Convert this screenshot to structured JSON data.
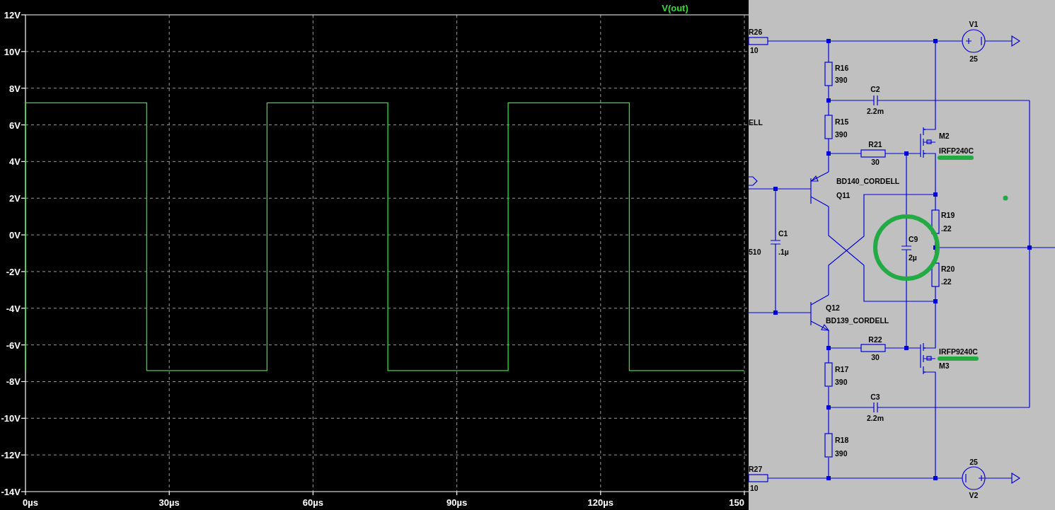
{
  "plot": {
    "chart_data": {
      "type": "line",
      "title": "V(out)",
      "grid": true,
      "xlim": [
        0,
        150
      ],
      "ylim": [
        -14,
        12
      ],
      "xticks": [
        {
          "value": 0,
          "label": "0µs"
        },
        {
          "value": 30,
          "label": "30µs"
        },
        {
          "value": 60,
          "label": "60µs"
        },
        {
          "value": 90,
          "label": "90µs"
        },
        {
          "value": 120,
          "label": "120µs"
        },
        {
          "value": 150,
          "label": "150"
        }
      ],
      "yticks": [
        {
          "value": 12,
          "label": "12V"
        },
        {
          "value": 10,
          "label": "10V"
        },
        {
          "value": 8,
          "label": "8V"
        },
        {
          "value": 6,
          "label": "6V"
        },
        {
          "value": 4,
          "label": "4V"
        },
        {
          "value": 2,
          "label": "2V"
        },
        {
          "value": 0,
          "label": "0V"
        },
        {
          "value": -2,
          "label": "-2V"
        },
        {
          "value": -4,
          "label": "-4V"
        },
        {
          "value": -6,
          "label": "-6V"
        },
        {
          "value": -8,
          "label": "-8V"
        },
        {
          "value": -10,
          "label": "-10V"
        },
        {
          "value": -12,
          "label": "-12V"
        },
        {
          "value": -14,
          "label": "-14V"
        }
      ],
      "x": [
        0,
        0,
        25.3,
        25.3,
        50.4,
        50.4,
        75.6,
        75.6,
        100.7,
        100.7,
        126,
        126,
        150
      ],
      "series": [
        {
          "color": "#33dd33",
          "values": [
            -7.4,
            7.2,
            7.2,
            -7.4,
            -7.4,
            7.2,
            7.2,
            -7.4,
            -7.4,
            7.2,
            7.2,
            -7.4,
            -7.4
          ]
        }
      ]
    }
  },
  "schematic": {
    "labels": [
      "R26",
      "10",
      "V1",
      "25",
      "R16",
      "390",
      "C2",
      "2.2m",
      "ELL",
      "R15",
      "390",
      "M2",
      "R21",
      "IRFP240C",
      "30",
      "BD140_CORDELL",
      "Q11",
      "R19",
      "C1",
      ".22",
      "C9",
      "510",
      ".1µ",
      "2µ",
      "R20",
      ".22",
      "Q12",
      "BD139_CORDELL",
      "R22",
      "IRFP9240C",
      "30",
      "M3",
      "R17",
      "390",
      "C3",
      "2.2m",
      "R18",
      "390",
      "25",
      "R27",
      "10",
      "V2"
    ]
  }
}
